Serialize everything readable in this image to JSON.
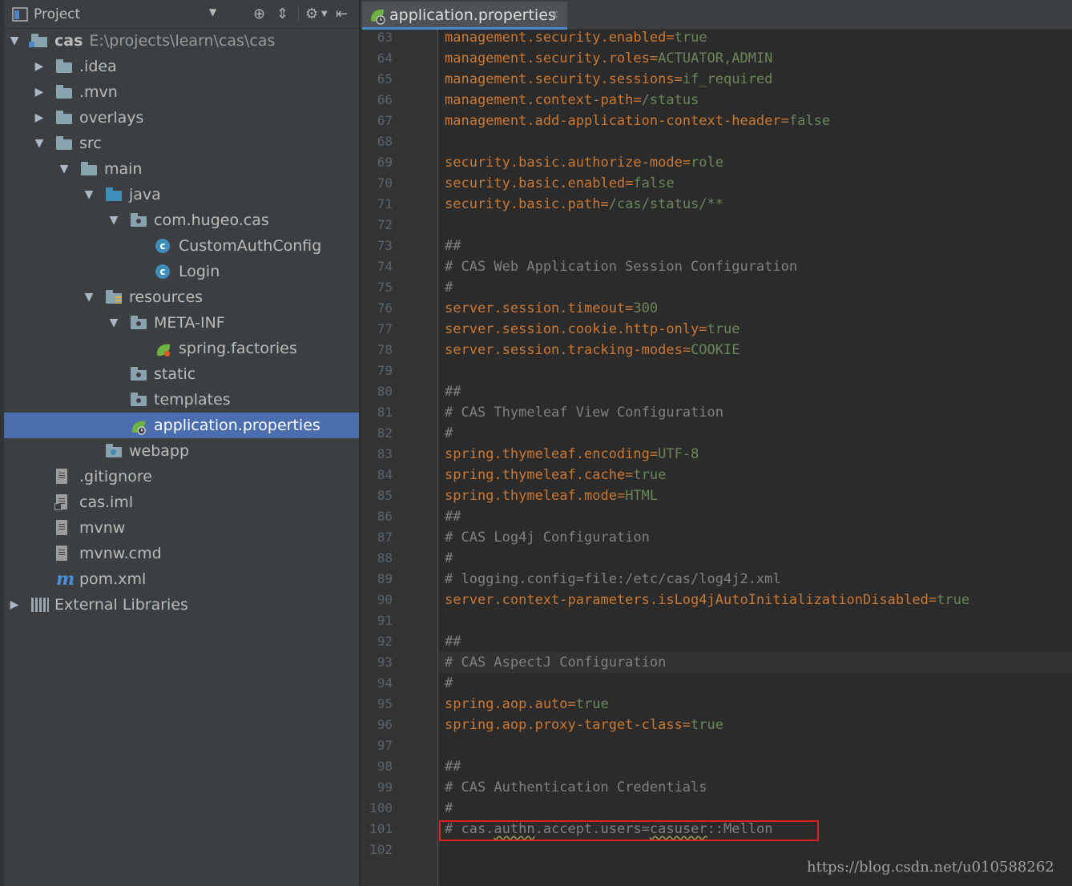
{
  "project_panel": {
    "title": "Project",
    "tree": [
      {
        "label": "cas",
        "path": "E:\\projects\\learn\\cas\\cas",
        "depth": 0,
        "arrow": "down",
        "icon": "module-folder-icon"
      },
      {
        "label": ".idea",
        "depth": 1,
        "arrow": "right",
        "icon": "folder-icon"
      },
      {
        "label": ".mvn",
        "depth": 1,
        "arrow": "right",
        "icon": "folder-icon"
      },
      {
        "label": "overlays",
        "depth": 1,
        "arrow": "right",
        "icon": "folder-icon"
      },
      {
        "label": "src",
        "depth": 1,
        "arrow": "down",
        "icon": "folder-icon"
      },
      {
        "label": "main",
        "depth": 2,
        "arrow": "down",
        "icon": "folder-icon"
      },
      {
        "label": "java",
        "depth": 3,
        "arrow": "down",
        "icon": "source-folder-icon"
      },
      {
        "label": "com.hugeo.cas",
        "depth": 4,
        "arrow": "down",
        "icon": "package-icon"
      },
      {
        "label": "CustomAuthConfig",
        "depth": 5,
        "arrow": "",
        "icon": "class-icon"
      },
      {
        "label": "Login",
        "depth": 5,
        "arrow": "",
        "icon": "class-icon"
      },
      {
        "label": "resources",
        "depth": 3,
        "arrow": "down",
        "icon": "resources-folder-icon"
      },
      {
        "label": "META-INF",
        "depth": 4,
        "arrow": "down",
        "icon": "package-icon"
      },
      {
        "label": "spring.factories",
        "depth": 5,
        "arrow": "",
        "icon": "spring-factories-icon"
      },
      {
        "label": "static",
        "depth": 4,
        "arrow": "",
        "icon": "package-icon"
      },
      {
        "label": "templates",
        "depth": 4,
        "arrow": "",
        "icon": "package-icon"
      },
      {
        "label": "application.properties",
        "depth": 4,
        "arrow": "",
        "icon": "spring-properties-icon",
        "selected": true
      },
      {
        "label": "webapp",
        "depth": 3,
        "arrow": "",
        "icon": "web-folder-icon"
      },
      {
        "label": ".gitignore",
        "depth": 1,
        "arrow": "",
        "icon": "text-file-icon"
      },
      {
        "label": "cas.iml",
        "depth": 1,
        "arrow": "",
        "icon": "iml-file-icon"
      },
      {
        "label": "mvnw",
        "depth": 1,
        "arrow": "",
        "icon": "text-file-icon"
      },
      {
        "label": "mvnw.cmd",
        "depth": 1,
        "arrow": "",
        "icon": "text-file-icon"
      },
      {
        "label": "pom.xml",
        "depth": 1,
        "arrow": "",
        "icon": "maven-icon"
      },
      {
        "label": "External Libraries",
        "depth": 0,
        "arrow": "right",
        "icon": "libraries-icon"
      }
    ]
  },
  "editor": {
    "tab_label": "application.properties",
    "tab_close": "×",
    "lines": [
      {
        "n": "63",
        "parts": [
          [
            "k",
            "management.security.enabled"
          ],
          [
            "k",
            "="
          ],
          [
            "v",
            "true"
          ]
        ]
      },
      {
        "n": "64",
        "parts": [
          [
            "k",
            "management.security.roles"
          ],
          [
            "k",
            "="
          ],
          [
            "v",
            "ACTUATOR,ADMIN"
          ]
        ]
      },
      {
        "n": "65",
        "parts": [
          [
            "k",
            "management.security.sessions"
          ],
          [
            "k",
            "="
          ],
          [
            "v",
            "if_required"
          ]
        ]
      },
      {
        "n": "66",
        "parts": [
          [
            "k",
            "management.context-path"
          ],
          [
            "k",
            "="
          ],
          [
            "v",
            "/status"
          ]
        ]
      },
      {
        "n": "67",
        "parts": [
          [
            "k",
            "management.add-application-context-header"
          ],
          [
            "k",
            "="
          ],
          [
            "v",
            "false"
          ]
        ]
      },
      {
        "n": "68",
        "parts": []
      },
      {
        "n": "69",
        "parts": [
          [
            "k",
            "security.basic.authorize-mode"
          ],
          [
            "k",
            "="
          ],
          [
            "v",
            "role"
          ]
        ]
      },
      {
        "n": "70",
        "parts": [
          [
            "k",
            "security.basic.enabled"
          ],
          [
            "k",
            "="
          ],
          [
            "v",
            "false"
          ]
        ]
      },
      {
        "n": "71",
        "parts": [
          [
            "k",
            "security.basic.path"
          ],
          [
            "k",
            "="
          ],
          [
            "v",
            "/cas/status/**"
          ]
        ]
      },
      {
        "n": "72",
        "parts": []
      },
      {
        "n": "73",
        "parts": [
          [
            "c",
            "##"
          ]
        ]
      },
      {
        "n": "74",
        "parts": [
          [
            "c",
            "# CAS Web Application Session Configuration"
          ]
        ]
      },
      {
        "n": "75",
        "parts": [
          [
            "c",
            "#"
          ]
        ]
      },
      {
        "n": "76",
        "parts": [
          [
            "k",
            "server.session.timeout"
          ],
          [
            "k",
            "="
          ],
          [
            "v",
            "300"
          ]
        ]
      },
      {
        "n": "77",
        "parts": [
          [
            "k",
            "server.session.cookie.http-only"
          ],
          [
            "k",
            "="
          ],
          [
            "v",
            "true"
          ]
        ]
      },
      {
        "n": "78",
        "parts": [
          [
            "k",
            "server.session.tracking-modes"
          ],
          [
            "k",
            "="
          ],
          [
            "v",
            "COOKIE"
          ]
        ]
      },
      {
        "n": "79",
        "parts": []
      },
      {
        "n": "80",
        "parts": [
          [
            "c",
            "##"
          ]
        ]
      },
      {
        "n": "81",
        "parts": [
          [
            "c",
            "# CAS Thymeleaf View Configuration"
          ]
        ]
      },
      {
        "n": "82",
        "parts": [
          [
            "c",
            "#"
          ]
        ]
      },
      {
        "n": "83",
        "parts": [
          [
            "k",
            "spring.thymeleaf.encoding"
          ],
          [
            "k",
            "="
          ],
          [
            "v",
            "UTF-8"
          ]
        ]
      },
      {
        "n": "84",
        "parts": [
          [
            "k",
            "spring.thymeleaf.cache"
          ],
          [
            "k",
            "="
          ],
          [
            "v",
            "true"
          ]
        ]
      },
      {
        "n": "85",
        "parts": [
          [
            "k",
            "spring.thymeleaf.mode"
          ],
          [
            "k",
            "="
          ],
          [
            "v",
            "HTML"
          ]
        ]
      },
      {
        "n": "86",
        "parts": [
          [
            "c",
            "##"
          ]
        ]
      },
      {
        "n": "87",
        "parts": [
          [
            "c",
            "# CAS Log4j Configuration"
          ]
        ]
      },
      {
        "n": "88",
        "parts": [
          [
            "c",
            "#"
          ]
        ]
      },
      {
        "n": "89",
        "parts": [
          [
            "c",
            "# logging.config=file:/etc/cas/log4j2.xml"
          ]
        ]
      },
      {
        "n": "90",
        "parts": [
          [
            "k",
            "server.context-parameters.isLog4jAutoInitializationDisabled"
          ],
          [
            "k",
            "="
          ],
          [
            "v",
            "true"
          ]
        ]
      },
      {
        "n": "91",
        "parts": []
      },
      {
        "n": "92",
        "parts": [
          [
            "c",
            "##"
          ]
        ]
      },
      {
        "n": "93",
        "parts": [
          [
            "c",
            "# CAS AspectJ Configuration"
          ]
        ]
      },
      {
        "n": "94",
        "parts": [
          [
            "c",
            "#"
          ]
        ]
      },
      {
        "n": "95",
        "parts": [
          [
            "k",
            "spring.aop.auto"
          ],
          [
            "k",
            "="
          ],
          [
            "v",
            "true"
          ]
        ]
      },
      {
        "n": "96",
        "parts": [
          [
            "k",
            "spring.aop.proxy-target-class"
          ],
          [
            "k",
            "="
          ],
          [
            "v",
            "true"
          ]
        ]
      },
      {
        "n": "97",
        "parts": []
      },
      {
        "n": "98",
        "parts": [
          [
            "c",
            "##"
          ]
        ]
      },
      {
        "n": "99",
        "parts": [
          [
            "c",
            "# CAS Authentication Credentials"
          ]
        ]
      },
      {
        "n": "100",
        "parts": [
          [
            "c",
            "#"
          ]
        ]
      },
      {
        "n": "101",
        "parts": [
          [
            "c",
            "# cas."
          ],
          [
            "cs",
            "authn"
          ],
          [
            "c",
            ".accept.users="
          ],
          [
            "cs",
            "casuser"
          ],
          [
            "c",
            "::Mellon"
          ]
        ]
      },
      {
        "n": "102",
        "parts": []
      }
    ]
  },
  "watermark": "https://blog.csdn.net/u010588262",
  "colors": {
    "panel_bg": "#3c3f41",
    "editor_bg": "#2b2b2b",
    "selection": "#4b6eaf",
    "key": "#cc7832",
    "value": "#6a8759",
    "comment": "#808080",
    "highlight_box": "#e02020"
  }
}
